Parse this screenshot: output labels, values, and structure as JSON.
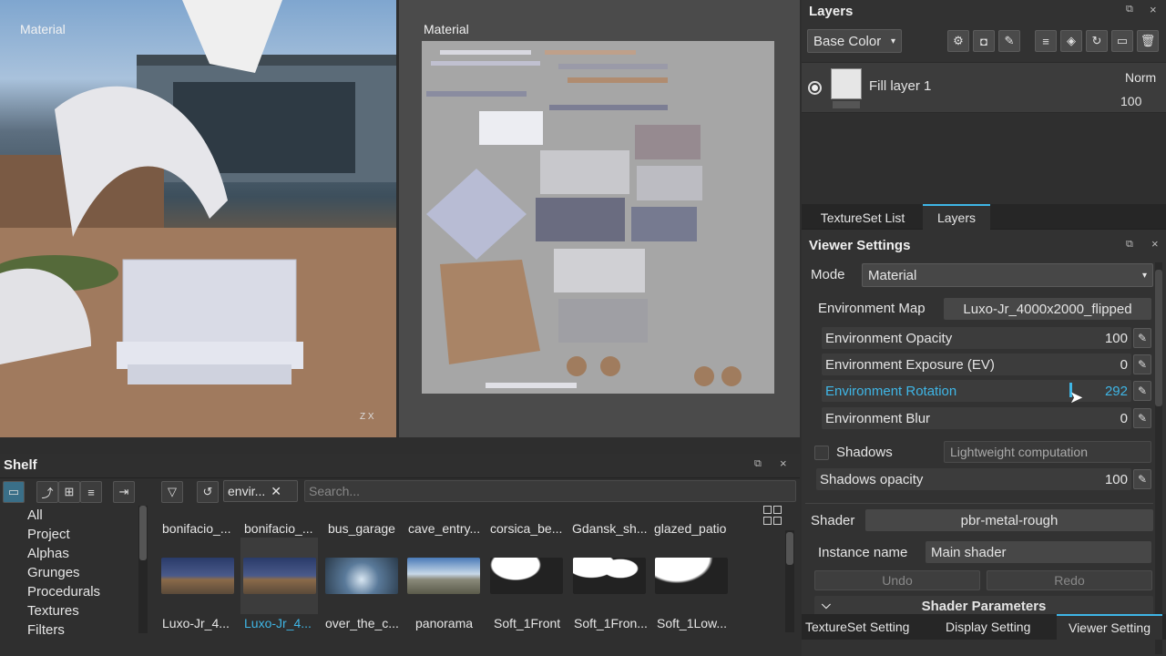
{
  "viewport3d": {
    "label": "Material",
    "axis_hint": "Z X"
  },
  "viewport2d": {
    "label": "Material"
  },
  "layers_panel": {
    "title": "Layers",
    "channel_dropdown": "Base Color",
    "layer": {
      "name": "Fill layer 1",
      "blend_mode": "Norm",
      "opacity": "100"
    },
    "tabs": [
      "TextureSet List",
      "Layers"
    ]
  },
  "viewer_settings": {
    "title": "Viewer Settings",
    "mode_label": "Mode",
    "mode_value": "Material",
    "env_map_label": "Environment Map",
    "env_map_value": "Luxo-Jr_4000x2000_flipped",
    "sliders": [
      {
        "label": "Environment Opacity",
        "value": "100"
      },
      {
        "label": "Environment Exposure (EV)",
        "value": "0"
      },
      {
        "label": "Environment Rotation",
        "value": "292"
      },
      {
        "label": "Environment Blur",
        "value": "0"
      }
    ],
    "shadows_label": "Shadows",
    "shadows_mode": "Lightweight computation",
    "shadows_opacity_label": "Shadows opacity",
    "shadows_opacity_value": "100",
    "shader_label": "Shader",
    "shader_value": "pbr-metal-rough",
    "instance_label": "Instance name",
    "instance_value": "Main shader",
    "undo_label": "Undo",
    "redo_label": "Redo",
    "shader_params_label": "Shader Parameters",
    "bottom_tabs": [
      "TextureSet Setting",
      "Display Setting",
      "Viewer Setting"
    ]
  },
  "shelf": {
    "title": "Shelf",
    "filter_tag": "envir...",
    "search_placeholder": "Search...",
    "categories": [
      "All",
      "Project",
      "Alphas",
      "Grunges",
      "Procedurals",
      "Textures",
      "Filters"
    ],
    "top_labels": [
      "bonifacio_...",
      "bonifacio_...",
      "bus_garage",
      "cave_entry...",
      "corsica_be...",
      "Gdansk_sh...",
      "glazed_patio"
    ],
    "bottom_labels": [
      "Luxo-Jr_4...",
      "Luxo-Jr_4...",
      "over_the_c...",
      "panorama",
      "Soft_1Front",
      "Soft_1Fron...",
      "Soft_1Low..."
    ]
  },
  "colors": {
    "accent": "#3fb6e6",
    "panel_bg": "#323232"
  }
}
